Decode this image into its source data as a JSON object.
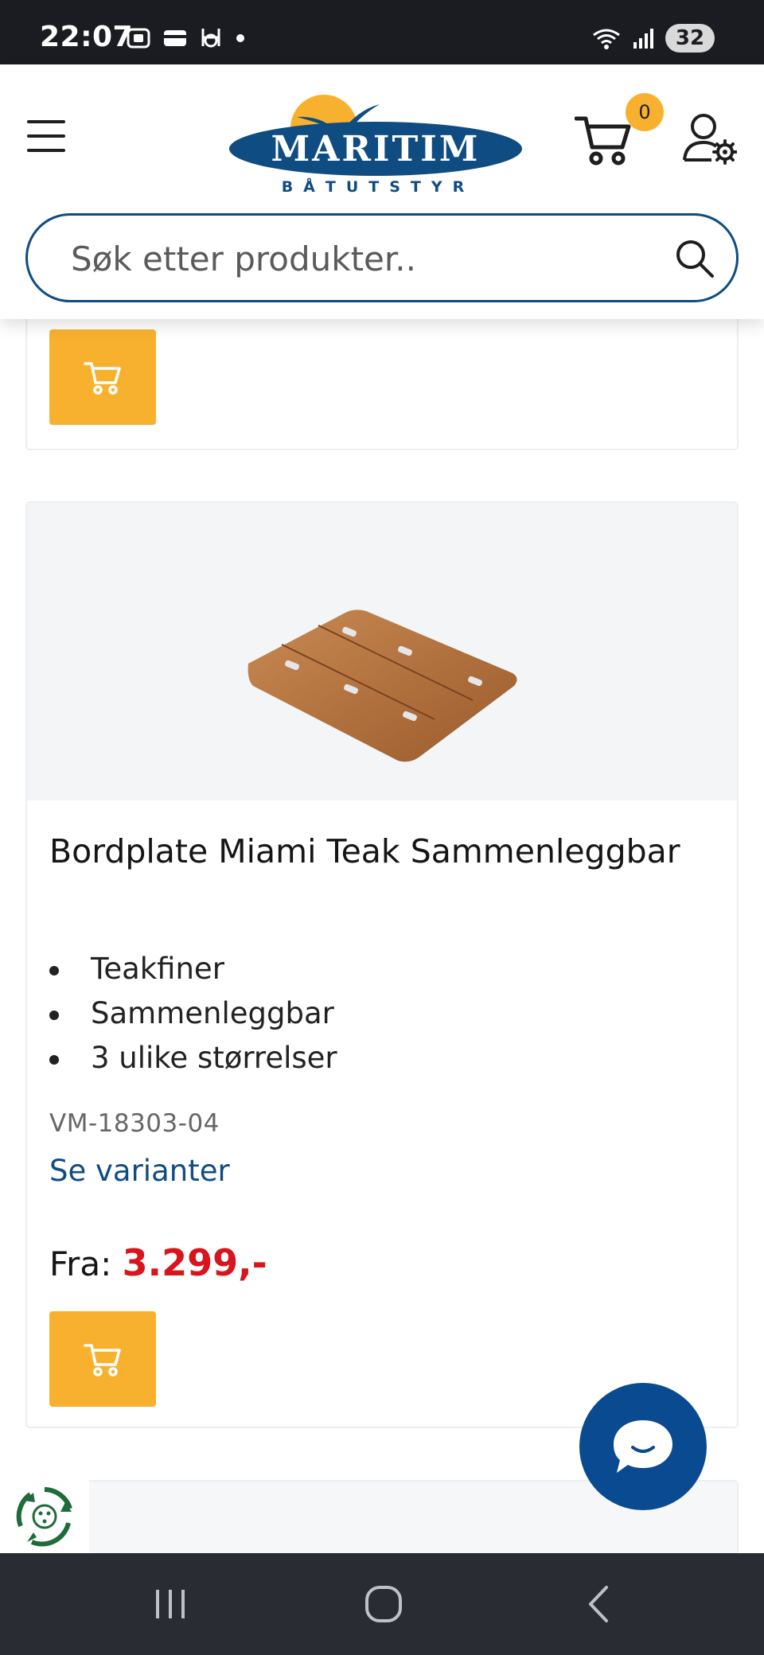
{
  "status_bar": {
    "time": "22:07",
    "battery": "32",
    "left_icons": [
      "screenshot-icon",
      "wallet-icon",
      "husqvarna-icon",
      "dot-icon"
    ],
    "right_icons": [
      "wifi-icon",
      "signal-icon",
      "battery-icon"
    ]
  },
  "header": {
    "logo_text": "MARITIM",
    "logo_subtitle": "BÅTUTSTYR",
    "cart_count": "0",
    "colors": {
      "brand_blue": "#0f4c82",
      "accent_yellow": "#f7b12e"
    }
  },
  "search": {
    "placeholder": "Søk etter produkter.."
  },
  "products": [
    {
      "title": "Bordplate Miami Teak Sammenleggbar",
      "features": [
        "Teakfiner",
        "Sammenleggbar",
        "3 ulike størrelser"
      ],
      "sku": "VM-18303-04",
      "variants_link": "Se varianter",
      "price_prefix": "Fra:",
      "price": "3.299,-"
    }
  ],
  "colors": {
    "price_red": "#d8141c",
    "chat_blue": "#0a4a90"
  }
}
